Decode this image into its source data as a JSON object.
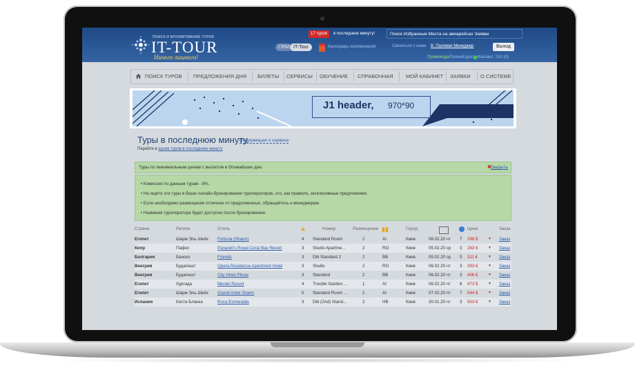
{
  "header": {
    "logo_small": "ПОИСК И БРОНИРОВАНИЕ ТУРОВ",
    "logo_main": "IT-TOUR",
    "logo_tagline": "Ничего лишнего!",
    "crm_label": "CRM",
    "ittour_label": "IT-Tour",
    "last_minute_badge": "17 туров",
    "last_minute_text": "в последнюю минуту!",
    "top_links": "Поиск  Избранные  Места на авиарейсах  Заявки",
    "calendar_label": "Календарь напоминаний",
    "contact_label": "Связаться с нами",
    "manager_label": "В. Палевая Менеджер",
    "exit_label": "Выход",
    "promo_label": "Промокоды",
    "access_label": "Полный доступ",
    "balance_label": "Баланс: 210 (0)"
  },
  "nav": {
    "items": [
      "ПОИСК ТУРОВ",
      "ПРЕДЛОЖЕНИЯ ДНЯ",
      "БИЛЕТЫ",
      "СЕРВИСЫ",
      "ОБУЧЕНИЕ",
      "СПРАВОЧНАЯ",
      "МОЙ КАБИНЕТ",
      "ЗАЯВКИ",
      "О СИСТЕМЕ"
    ]
  },
  "banner": {
    "title": "J1 header,",
    "size": "970*90"
  },
  "main": {
    "title": "Туры в последнюю минуту.",
    "info_link": "Информация о сервисе",
    "archive_prefix": "Перейти в ",
    "archive_link": "архив туров в последнюю минуту"
  },
  "notice": {
    "heading": "Туры по минимальным ценам с вылетом в ближайшие дни.",
    "close_label": "Закрыть",
    "items": [
      "•  Комиссия по данным турам - 8%.",
      "•  Не ищите эти туры в базах онлайн-бронирования туроператоров, это, как правило, эксклюзивные предложения.",
      "•  Если необходимо размещение отличное от предложенных, обращайтесь к менеджерам.",
      "•  Названия туроператора будет доступно после бронирования."
    ]
  },
  "table": {
    "headers": [
      "Страна",
      "Регион",
      "Отель",
      "Номер",
      "Размещение",
      "Город",
      "Цена",
      "Заказ"
    ],
    "rows": [
      {
        "country": "Египет",
        "region": "Шарм Эль Шейх",
        "hotel": "Fortuna (Sharm)",
        "stars": "4",
        "room": "Standard Room",
        "people": "2",
        "meal": "AI",
        "city": "Киев",
        "date": "06.02.20 чт",
        "nights": "7",
        "price": "298 $",
        "order": "Заказ"
      },
      {
        "country": "Кипр",
        "region": "Пафос",
        "hotel": "Panareti's Royal Coral Bay Resort",
        "stars": "3",
        "room": "Studio Apartme...",
        "people": "2",
        "meal": "RO",
        "city": "Киев",
        "date": "05.02.20 ср",
        "nights": "3",
        "price": "283 €",
        "order": "Заказ"
      },
      {
        "country": "Болгария",
        "region": "Банско",
        "hotel": "Friends",
        "stars": "3",
        "room": "Dbl Standard 2",
        "people": "2",
        "meal": "BB",
        "city": "Киев",
        "date": "05.02.20 ср",
        "nights": "5",
        "price": "311 €",
        "order": "Заказ"
      },
      {
        "country": "Венгрия",
        "region": "Будапешт",
        "hotel": "Opera Residence Apartment Hotel",
        "stars": "3",
        "room": "Studio",
        "people": "2",
        "meal": "RO",
        "city": "Киев",
        "date": "06.02.20 чт",
        "nights": "3",
        "price": "393 €",
        "order": "Заказ"
      },
      {
        "country": "Венгрия",
        "region": "Будапешт",
        "hotel": "City Hotel Pilvax",
        "stars": "3",
        "room": "Standard",
        "people": "2",
        "meal": "BB",
        "city": "Киев",
        "date": "06.02.20 чт",
        "nights": "3",
        "price": "406 €",
        "order": "Заказ"
      },
      {
        "country": "Египет",
        "region": "Хургада",
        "hotel": "Meraki Resort",
        "stars": "4",
        "room": "Trouble Garden ...",
        "people": "1",
        "meal": "AI",
        "city": "Киев",
        "date": "06.02.20 чт",
        "nights": "6",
        "price": "473 $",
        "order": "Заказ"
      },
      {
        "country": "Египет",
        "region": "Шарм Эль Шейх",
        "hotel": "Grand Hotel Sharm",
        "stars": "5",
        "room": "Standard Room ...",
        "people": "2",
        "meal": "AI",
        "city": "Киев",
        "date": "07.02.20 пт",
        "nights": "7",
        "price": "544 $",
        "order": "Заказ"
      },
      {
        "country": "Испания",
        "region": "Коста Бланка",
        "hotel": "Roca Esmeralda",
        "stars": "3",
        "room": "Dbl (2Ad) Stand...",
        "people": "2",
        "meal": "HB",
        "city": "Киев",
        "date": "30.01.20 чт",
        "nights": "3",
        "price": "503 €",
        "order": "Заказ"
      }
    ]
  },
  "colors": {
    "header_bg": "#1f4a86",
    "notice_bg": "#b5d8a6",
    "link": "#2a5aa8",
    "price": "#cc2222"
  }
}
